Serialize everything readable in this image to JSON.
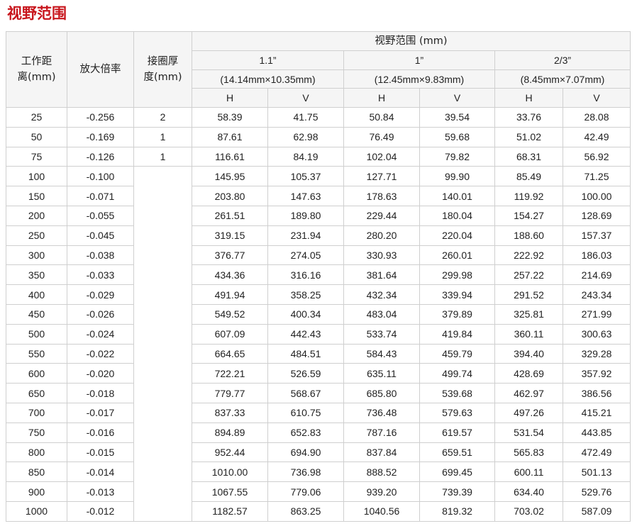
{
  "title": "视野范围",
  "headers": {
    "wd_line1": "工作距",
    "wd_line2": "离(mm)",
    "mag": "放大倍率",
    "ring_line1": "接圈厚",
    "ring_line2": "度(mm)",
    "fov": "视野范围 (mm)",
    "sensors": [
      {
        "name": "1.1”",
        "size": "(14.14mm×10.35mm)"
      },
      {
        "name": "1”",
        "size": "(12.45mm×9.83mm)"
      },
      {
        "name": "2/3”",
        "size": "(8.45mm×7.07mm)"
      }
    ],
    "h": "H",
    "v": "V"
  },
  "rows": [
    {
      "wd": "25",
      "mag": "-0.256",
      "ring": "2",
      "h1": "58.39",
      "v1": "41.75",
      "h2": "50.84",
      "v2": "39.54",
      "h3": "33.76",
      "v3": "28.08"
    },
    {
      "wd": "50",
      "mag": "-0.169",
      "ring": "1",
      "h1": "87.61",
      "v1": "62.98",
      "h2": "76.49",
      "v2": "59.68",
      "h3": "51.02",
      "v3": "42.49"
    },
    {
      "wd": "75",
      "mag": "-0.126",
      "ring": "1",
      "h1": "116.61",
      "v1": "84.19",
      "h2": "102.04",
      "v2": "79.82",
      "h3": "68.31",
      "v3": "56.92"
    },
    {
      "wd": "100",
      "mag": "-0.100",
      "ring": "",
      "h1": "145.95",
      "v1": "105.37",
      "h2": "127.71",
      "v2": "99.90",
      "h3": "85.49",
      "v3": "71.25"
    },
    {
      "wd": "150",
      "mag": "-0.071",
      "ring": "",
      "h1": "203.80",
      "v1": "147.63",
      "h2": "178.63",
      "v2": "140.01",
      "h3": "119.92",
      "v3": "100.00"
    },
    {
      "wd": "200",
      "mag": "-0.055",
      "ring": "",
      "h1": "261.51",
      "v1": "189.80",
      "h2": "229.44",
      "v2": "180.04",
      "h3": "154.27",
      "v3": "128.69"
    },
    {
      "wd": "250",
      "mag": "-0.045",
      "ring": "",
      "h1": "319.15",
      "v1": "231.94",
      "h2": "280.20",
      "v2": "220.04",
      "h3": "188.60",
      "v3": "157.37"
    },
    {
      "wd": "300",
      "mag": "-0.038",
      "ring": "",
      "h1": "376.77",
      "v1": "274.05",
      "h2": "330.93",
      "v2": "260.01",
      "h3": "222.92",
      "v3": "186.03"
    },
    {
      "wd": "350",
      "mag": "-0.033",
      "ring": "",
      "h1": "434.36",
      "v1": "316.16",
      "h2": "381.64",
      "v2": "299.98",
      "h3": "257.22",
      "v3": "214.69"
    },
    {
      "wd": "400",
      "mag": "-0.029",
      "ring": "",
      "h1": "491.94",
      "v1": "358.25",
      "h2": "432.34",
      "v2": "339.94",
      "h3": "291.52",
      "v3": "243.34"
    },
    {
      "wd": "450",
      "mag": "-0.026",
      "ring": "",
      "h1": "549.52",
      "v1": "400.34",
      "h2": "483.04",
      "v2": "379.89",
      "h3": "325.81",
      "v3": "271.99"
    },
    {
      "wd": "500",
      "mag": "-0.024",
      "ring": "",
      "h1": "607.09",
      "v1": "442.43",
      "h2": "533.74",
      "v2": "419.84",
      "h3": "360.11",
      "v3": "300.63"
    },
    {
      "wd": "550",
      "mag": "-0.022",
      "ring": "",
      "h1": "664.65",
      "v1": "484.51",
      "h2": "584.43",
      "v2": "459.79",
      "h3": "394.40",
      "v3": "329.28"
    },
    {
      "wd": "600",
      "mag": "-0.020",
      "ring": "",
      "h1": "722.21",
      "v1": "526.59",
      "h2": "635.11",
      "v2": "499.74",
      "h3": "428.69",
      "v3": "357.92"
    },
    {
      "wd": "650",
      "mag": "-0.018",
      "ring": "",
      "h1": "779.77",
      "v1": "568.67",
      "h2": "685.80",
      "v2": "539.68",
      "h3": "462.97",
      "v3": "386.56"
    },
    {
      "wd": "700",
      "mag": "-0.017",
      "ring": "",
      "h1": "837.33",
      "v1": "610.75",
      "h2": "736.48",
      "v2": "579.63",
      "h3": "497.26",
      "v3": "415.21"
    },
    {
      "wd": "750",
      "mag": "-0.016",
      "ring": "",
      "h1": "894.89",
      "v1": "652.83",
      "h2": "787.16",
      "v2": "619.57",
      "h3": "531.54",
      "v3": "443.85"
    },
    {
      "wd": "800",
      "mag": "-0.015",
      "ring": "",
      "h1": "952.44",
      "v1": "694.90",
      "h2": "837.84",
      "v2": "659.51",
      "h3": "565.83",
      "v3": "472.49"
    },
    {
      "wd": "850",
      "mag": "-0.014",
      "ring": "",
      "h1": "1010.00",
      "v1": "736.98",
      "h2": "888.52",
      "v2": "699.45",
      "h3": "600.11",
      "v3": "501.13"
    },
    {
      "wd": "900",
      "mag": "-0.013",
      "ring": "",
      "h1": "1067.55",
      "v1": "779.06",
      "h2": "939.20",
      "v2": "739.39",
      "h3": "634.40",
      "v3": "529.76"
    },
    {
      "wd": "1000",
      "mag": "-0.012",
      "ring": "",
      "h1": "1182.57",
      "v1": "863.25",
      "h2": "1040.56",
      "v2": "819.32",
      "h3": "703.02",
      "v3": "587.09"
    }
  ],
  "colors": {
    "title": "#c8161d",
    "header_bg": "#f5f5f5",
    "border": "#cfcfcf"
  }
}
